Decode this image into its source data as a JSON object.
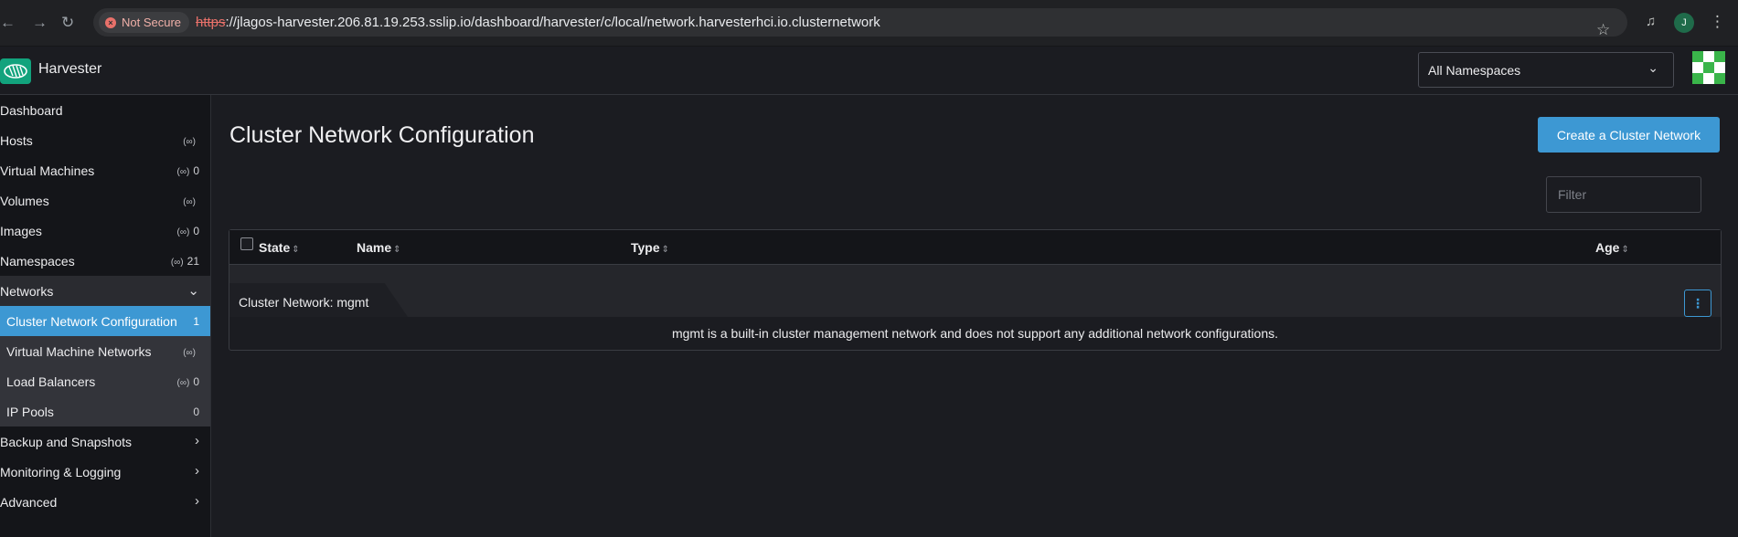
{
  "browser": {
    "security_label": "Not Secure",
    "url_scheme": "https",
    "url_rest": "://jlagos-harvester.206.81.19.253.sslip.io/dashboard/harvester/c/local/network.harvesterhci.io.clusternetwork",
    "profile_initial": "J",
    "icons": [
      "back-icon",
      "forward-icon",
      "reload-icon",
      "star-icon",
      "media-icon",
      "kebab-icon"
    ]
  },
  "header": {
    "app_name": "Harvester",
    "namespace_selected": "All Namespaces"
  },
  "sidebar": {
    "items": [
      {
        "label": "Dashboard",
        "meta": ""
      },
      {
        "label": "Hosts",
        "meta": ""
      },
      {
        "label": "Virtual Machines",
        "meta": "0"
      },
      {
        "label": "Volumes",
        "meta": ""
      },
      {
        "label": "Images",
        "meta": "0"
      },
      {
        "label": "Namespaces",
        "meta": "21"
      },
      {
        "label": "Networks",
        "meta": ""
      },
      {
        "label": "Cluster Network Configuration",
        "meta": "1"
      },
      {
        "label": "Virtual Machine Networks",
        "meta": ""
      },
      {
        "label": "Load Balancers",
        "meta": "0"
      },
      {
        "label": "IP Pools",
        "meta": "0"
      },
      {
        "label": "Backup and Snapshots",
        "meta": ""
      },
      {
        "label": "Monitoring & Logging",
        "meta": ""
      },
      {
        "label": "Advanced",
        "meta": ""
      }
    ]
  },
  "main": {
    "title": "Cluster Network Configuration",
    "create_button": "Create a Cluster Network",
    "filter_placeholder": "Filter",
    "columns": [
      "State",
      "Name",
      "Type",
      "Age"
    ],
    "group_label": "Cluster Network: mgmt",
    "group_message": "mgmt is a built-in cluster management network and does not support any additional network configurations."
  },
  "colors": {
    "accent": "#3d98d3",
    "brand": "#12a37d",
    "background": "#1b1c21",
    "sidebar": "#141519"
  }
}
